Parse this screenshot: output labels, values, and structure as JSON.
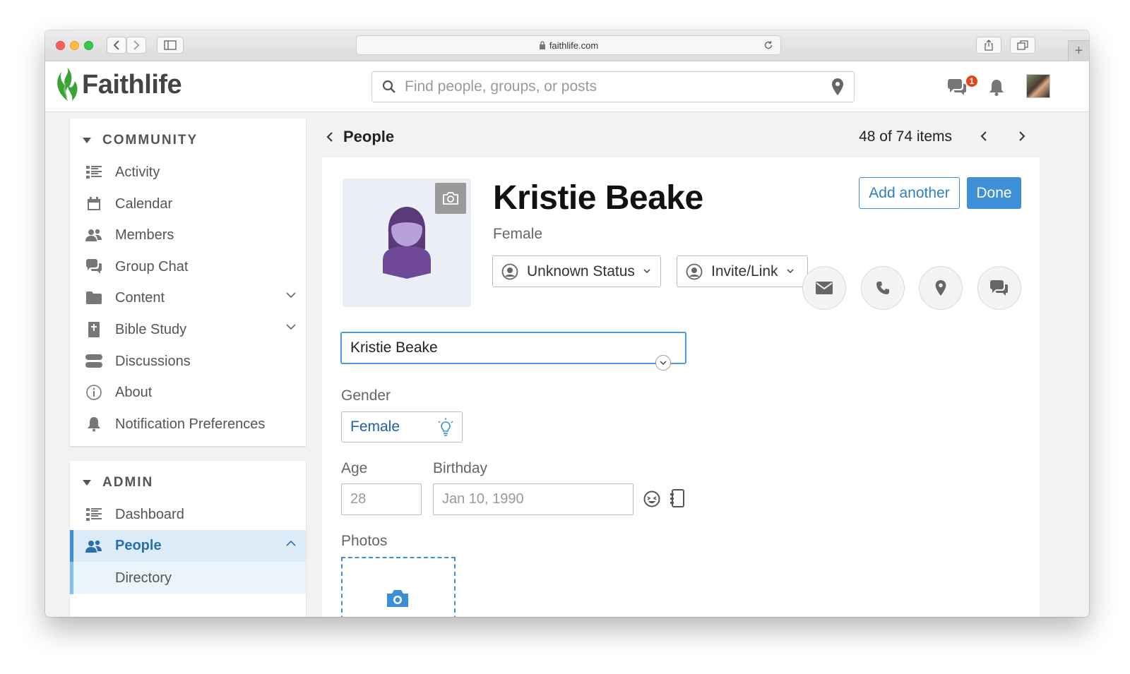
{
  "browser": {
    "url": "faithlife.com"
  },
  "app": {
    "logo_text": "Faithlife",
    "search_placeholder": "Find people, groups, or posts",
    "chat_badge": "1",
    "colors": {
      "accent": "#3e8fd8",
      "logo_green": "#3aa335",
      "badge": "#e0461e"
    }
  },
  "sidebar": {
    "community": {
      "title": "COMMUNITY",
      "items": [
        {
          "label": "Activity",
          "icon": "activity-icon"
        },
        {
          "label": "Calendar",
          "icon": "calendar-icon"
        },
        {
          "label": "Members",
          "icon": "members-icon"
        },
        {
          "label": "Group Chat",
          "icon": "group-chat-icon"
        },
        {
          "label": "Content",
          "icon": "folder-icon",
          "expandable": true
        },
        {
          "label": "Bible Study",
          "icon": "bible-icon",
          "expandable": true
        },
        {
          "label": "Discussions",
          "icon": "discussions-icon"
        },
        {
          "label": "About",
          "icon": "info-icon"
        },
        {
          "label": "Notification Preferences",
          "icon": "bell-icon"
        }
      ]
    },
    "admin": {
      "title": "ADMIN",
      "items": [
        {
          "label": "Dashboard",
          "icon": "dashboard-icon"
        },
        {
          "label": "People",
          "icon": "people-icon",
          "active": true,
          "expanded": true
        },
        {
          "label": "Directory",
          "sub": true
        }
      ]
    }
  },
  "main": {
    "breadcrumb": "People",
    "pager": "48 of 74 items",
    "person": {
      "name": "Kristie Beake",
      "gender": "Female",
      "status": "Unknown Status",
      "invite": "Invite/Link"
    },
    "actions": {
      "add_another": "Add another",
      "done": "Done"
    },
    "form": {
      "name_value": "Kristie Beake",
      "gender_label": "Gender",
      "gender_value": "Female",
      "age_label": "Age",
      "age_placeholder": "28",
      "birthday_label": "Birthday",
      "birthday_placeholder": "Jan 10, 1990",
      "photos_label": "Photos"
    }
  }
}
